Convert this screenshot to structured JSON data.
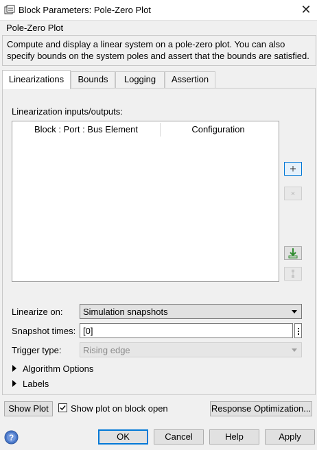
{
  "window": {
    "title": "Block Parameters: Pole-Zero Plot",
    "close_icon": "close-icon"
  },
  "description": {
    "group_title": "Pole-Zero Plot",
    "text": "Compute and display a linear system on a pole-zero plot. You can also specify bounds on the system poles and assert that the bounds are satisfied."
  },
  "tabs": [
    {
      "label": "Linearizations",
      "active": true
    },
    {
      "label": "Bounds",
      "active": false
    },
    {
      "label": "Logging",
      "active": false
    },
    {
      "label": "Assertion",
      "active": false
    }
  ],
  "linearizations": {
    "io_label": "Linearization inputs/outputs:",
    "columns": [
      "Block : Port : Bus Element",
      "Configuration"
    ],
    "rows": []
  },
  "form": {
    "linearize_on_label": "Linearize on:",
    "linearize_on_value": "Simulation snapshots",
    "snapshot_times_label": "Snapshot times:",
    "snapshot_times_value": "[0]",
    "trigger_type_label": "Trigger type:",
    "trigger_type_value": "Rising edge",
    "algorithm_options_label": "Algorithm Options",
    "labels_label": "Labels"
  },
  "footer": {
    "show_plot_label": "Show Plot",
    "show_on_open_label": "Show plot on block open",
    "show_on_open_checked": true,
    "response_opt_label": "Response Optimization...",
    "ok_label": "OK",
    "cancel_label": "Cancel",
    "help_label": "Help",
    "apply_label": "Apply"
  }
}
